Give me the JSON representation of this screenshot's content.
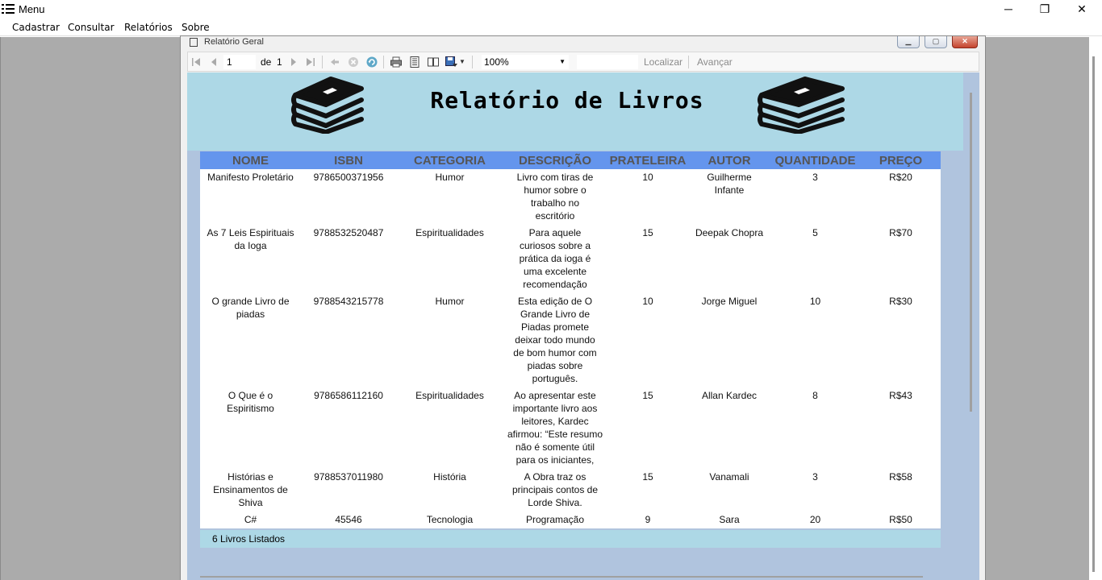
{
  "app": {
    "title": "Menu"
  },
  "window_controls": {
    "minimize": "─",
    "maximize": "❐",
    "close": "✕"
  },
  "menu": [
    "Cadastrar",
    "Consultar",
    "Relatórios",
    "Sobre"
  ],
  "child_window": {
    "title": "Relatório Geral"
  },
  "toolbar": {
    "page_value": "1",
    "page_of": "de",
    "page_total": "1",
    "zoom": "100%",
    "find_label": "Localizar",
    "next_label": "Avançar"
  },
  "report": {
    "title": "Relatório de Livros",
    "columns": [
      "NOME",
      "ISBN",
      "CATEGORIA",
      "DESCRIÇÃO",
      "PRATELEIRA",
      "AUTOR",
      "QUANTIDADE",
      "PREÇO"
    ],
    "rows": [
      [
        "Manifesto Proletário",
        "9786500371956",
        "Humor",
        "Livro com tiras de humor sobre o trabalho no escritório",
        "10",
        "Guilherme Infante",
        "3",
        "R$20"
      ],
      [
        "As 7 Leis Espirituais da Ioga",
        "9788532520487",
        "Espiritualidades",
        "Para aquele curiosos sobre a prática da ioga é uma excelente recomendação",
        "15",
        "Deepak Chopra",
        "5",
        "R$70"
      ],
      [
        "O grande Livro de piadas",
        "9788543215778",
        "Humor",
        "Esta edição de O Grande Livro de Piadas promete deixar todo mundo de bom humor com piadas sobre português.",
        "10",
        "Jorge Miguel",
        "10",
        "R$30"
      ],
      [
        "O Que é o Espiritismo",
        "9786586112160",
        "Espiritualidades",
        "Ao apresentar este importante livro aos leitores, Kardec afirmou: “Este resumo não é somente útil para os iniciantes,",
        "15",
        "Allan Kardec",
        "8",
        "R$43"
      ],
      [
        "Histórias e Ensinamentos de Shiva",
        "9788537011980",
        "História",
        "A Obra traz os principais contos de Lorde Shiva.",
        "15",
        "Vanamali",
        "3",
        "R$58"
      ],
      [
        "C#",
        "45546",
        "Tecnologia",
        "Programação",
        "9",
        "Sara",
        "20",
        "R$50"
      ]
    ],
    "footer": "6 Livros Listados"
  },
  "colors": {
    "header_band": "#add8e6",
    "column_header": "#6495ed",
    "viewport": "#b0c4de",
    "mdi_background": "#ababab"
  },
  "icons": [
    "menu-icon",
    "first-page-icon",
    "previous-page-icon",
    "next-page-icon",
    "last-page-icon",
    "back-icon",
    "stop-icon",
    "refresh-icon",
    "print-icon",
    "print-layout-icon",
    "page-setup-icon",
    "export-icon",
    "books-icon"
  ]
}
